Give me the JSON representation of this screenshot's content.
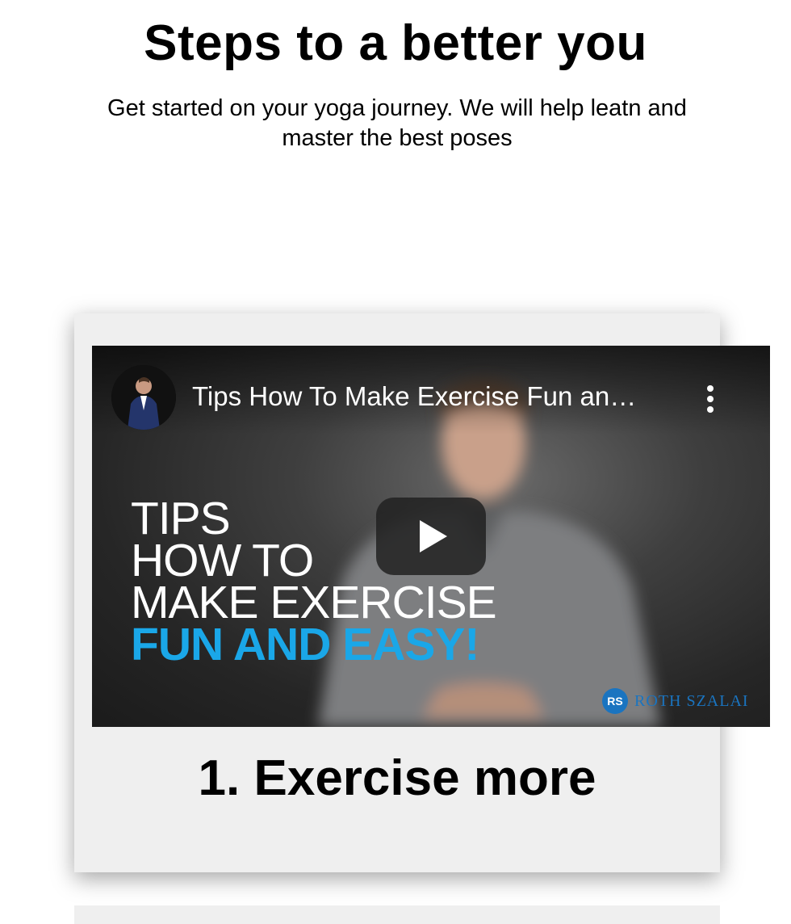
{
  "hero": {
    "title": "Steps to a better you",
    "subtitle": "Get started on your yoga journey. We will help leatn and master the best poses"
  },
  "steps": [
    {
      "title": "1. Exercise more",
      "video": {
        "title": "Tips How To Make Exercise Fun an…",
        "thumbnail_text": {
          "line1": "TIPS",
          "line2": "HOW TO",
          "line3": "MAKE EXERCISE",
          "line4": "FUN AND EASY!"
        },
        "watermark_initials": "RS",
        "watermark_name": "ROTH SZALAI",
        "accent_color": "#1aa7e8",
        "icons": [
          "channel-avatar",
          "more-vertical-icon",
          "play-icon"
        ]
      }
    }
  ]
}
